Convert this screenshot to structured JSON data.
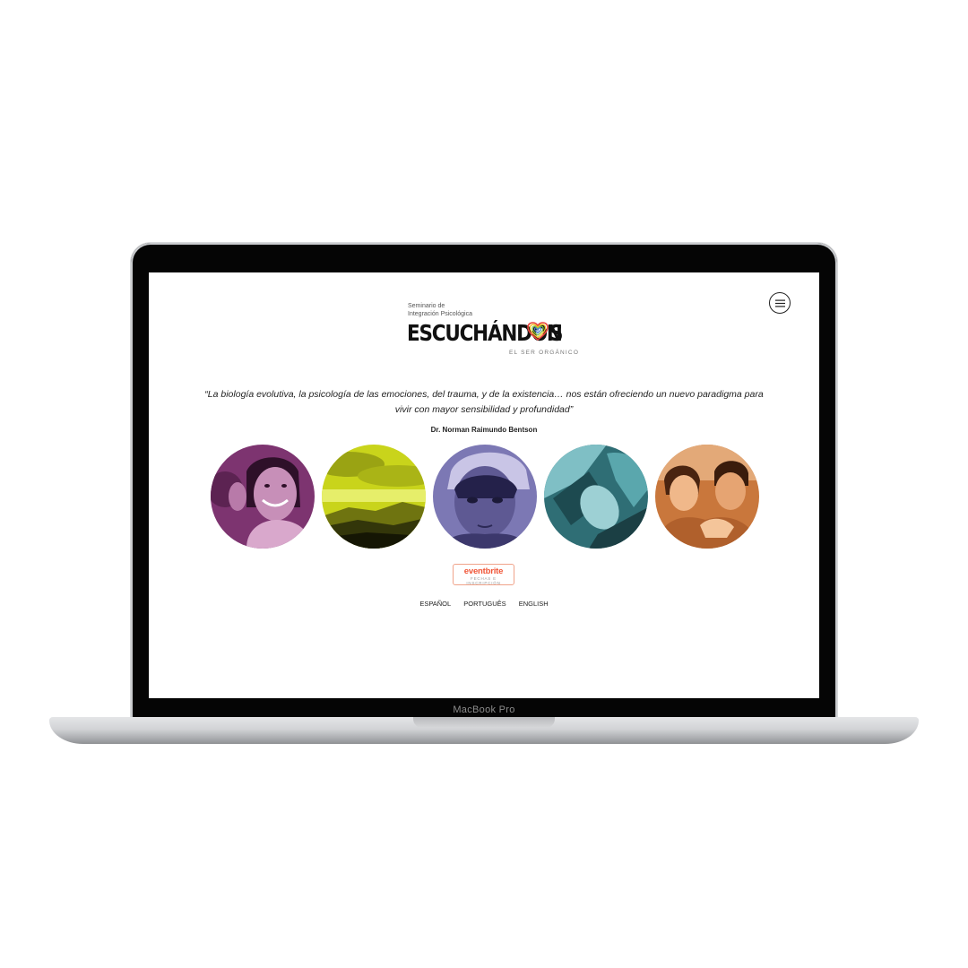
{
  "device": {
    "model_label": "MacBook Pro"
  },
  "header": {
    "logo_line1": "Seminario de",
    "logo_line2": "Integración Psicológica",
    "logo_text_a": "ESCUCHÁNDON",
    "logo_text_b": "S",
    "logo_tagline": "EL SER ORGÁNICO",
    "menu_icon": "hamburger-icon"
  },
  "quote": {
    "text": "“La biología evolutiva, la psicología de las emociones, del trauma, y de la existencia… nos están ofreciendo un nuevo paradigma para vivir con mayor sensibilidad y profundidad”",
    "author": "Dr. Norman Raimundo Bentson"
  },
  "gallery": [
    {
      "tint": "#8a3f7a"
    },
    {
      "tint": "#c6d11a"
    },
    {
      "tint": "#7a76b0"
    },
    {
      "tint": "#3c7f86"
    },
    {
      "tint": "#d18648"
    }
  ],
  "eventbrite": {
    "brand": "eventbrite",
    "subtitle": "FECHAS E INSCRIPCIÓN"
  },
  "languages": [
    "ESPAÑOL",
    "PORTUGUÊS",
    "ENGLISH"
  ]
}
